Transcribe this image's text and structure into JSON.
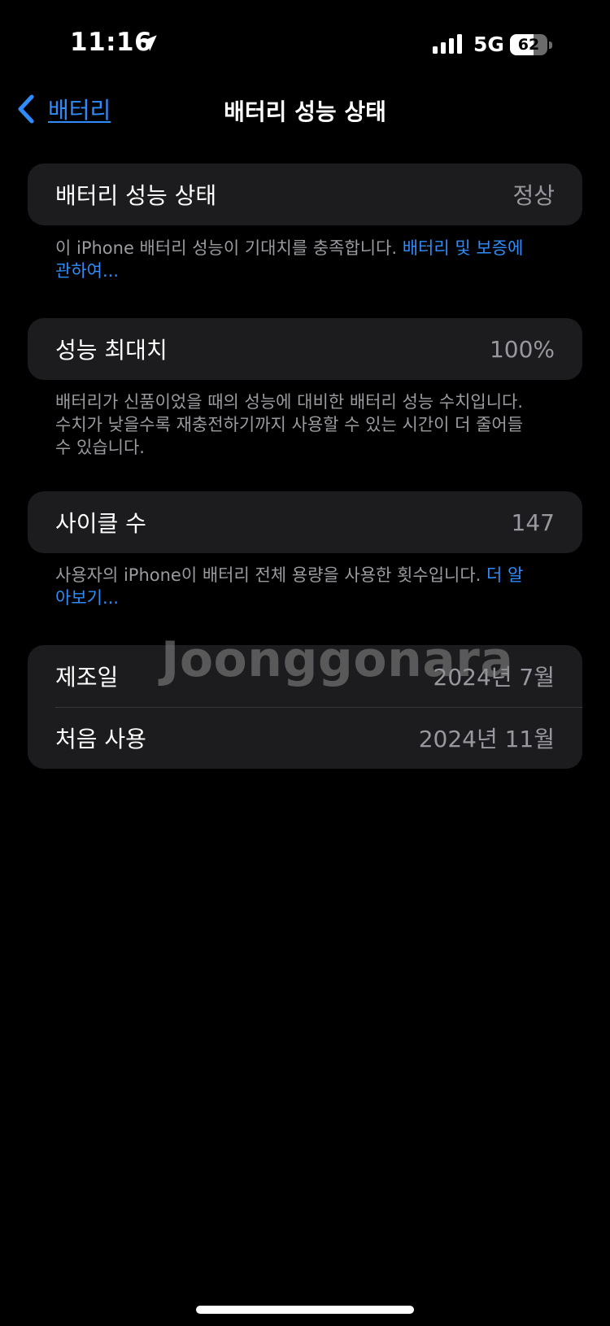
{
  "status_bar": {
    "time": "11:16",
    "network": "5G",
    "battery_level": "62",
    "battery_fraction": 0.62,
    "icons": [
      "location-arrow-icon",
      "cellular-signal-icon",
      "battery-icon"
    ]
  },
  "nav": {
    "back_label": "배터리",
    "title": "배터리 성능 상태"
  },
  "sections": {
    "health": {
      "label": "배터리 성능 상태",
      "value": "정상",
      "footnote_text": "이 iPhone 배터리 성능이 기대치를 충족합니다. ",
      "footnote_link": "배터리 및 보증에 관하여..."
    },
    "capacity": {
      "label": "성능 최대치",
      "value": "100%",
      "footnote_text": "배터리가 신품이었을 때의 성능에 대비한 배터리 성능 수치입니다. 수치가 낮을수록 재충전하기까지 사용할 수 있는 시간이 더 줄어들 수 있습니다."
    },
    "cycles": {
      "label": "사이클 수",
      "value": "147",
      "footnote_text": "사용자의 iPhone이 배터리 전체 용량을 사용한 횟수입니다. ",
      "footnote_link": "더 알아보기..."
    },
    "dates": {
      "manufactured_label": "제조일",
      "manufactured_value": "2024년 7월",
      "first_use_label": "처음 사용",
      "first_use_value": "2024년 11월"
    }
  },
  "watermark": "Joonggonara",
  "colors": {
    "background": "#000000",
    "card": "#1c1c1e",
    "accent": "#2f8cf9",
    "secondary_text": "#98989e"
  }
}
